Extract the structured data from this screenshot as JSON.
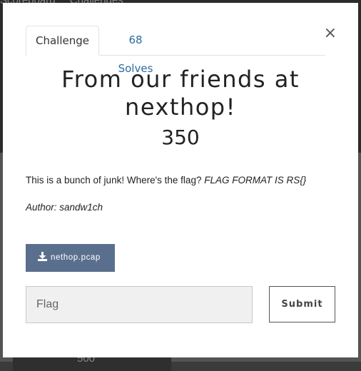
{
  "backdrop": {
    "nav_items": [
      "Scoreboard",
      "Challenges"
    ],
    "tile_value": "500"
  },
  "modal": {
    "close_glyph": "×",
    "tabs": [
      {
        "label": "Challenge",
        "active": true
      },
      {
        "label": "68 Solves",
        "active": false
      }
    ],
    "title": "From our friends at nexthop!",
    "points": "350",
    "description": "This is a bunch of junk! Where's the flag?",
    "description_emphasis": "FLAG FORMAT IS RS{}",
    "author": "Author: sandw1ch",
    "file": {
      "name": "nethop.pcap",
      "icon": "download-icon"
    },
    "flag_input": {
      "placeholder": "Flag",
      "value": ""
    },
    "submit_label": "Submit"
  },
  "colors": {
    "file_button": "#5a6f8d",
    "tab_link": "#2c6aa0",
    "input_bg": "#f0f0f0"
  }
}
